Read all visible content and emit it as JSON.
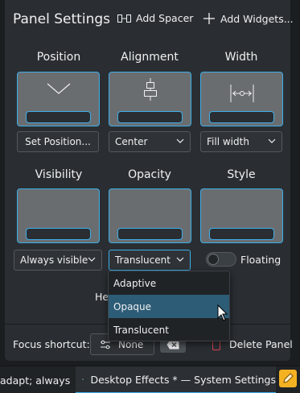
{
  "header": {
    "title": "Panel Settings",
    "add_spacer": "Add Spacer",
    "add_widgets": "Add Widgets..."
  },
  "sections": {
    "position": {
      "label": "Position",
      "button": "Set Position..."
    },
    "alignment": {
      "label": "Alignment",
      "value": "Center"
    },
    "width": {
      "label": "Width",
      "value": "Fill width"
    },
    "visibility": {
      "label": "Visibility",
      "value": "Always visible"
    },
    "opacity": {
      "label": "Opacity",
      "value": "Translucent"
    },
    "style": {
      "label": "Style",
      "toggle_label": "Floating",
      "toggle_on": false
    }
  },
  "opacity_menu": {
    "options": [
      "Adaptive",
      "Opaque",
      "Translucent"
    ],
    "highlighted": "Opaque"
  },
  "hint_text": "He",
  "footer": {
    "focus_label": "Focus shortcut:",
    "shortcut_value": "None",
    "delete_label": "Delete Panel"
  },
  "taskbar": {
    "task1": "adapt; always ...",
    "task2": "Desktop Effects * — System Settings"
  },
  "colors": {
    "accent": "#3daee9",
    "panel_bg": "#2a2e32",
    "danger": "#da4453"
  }
}
